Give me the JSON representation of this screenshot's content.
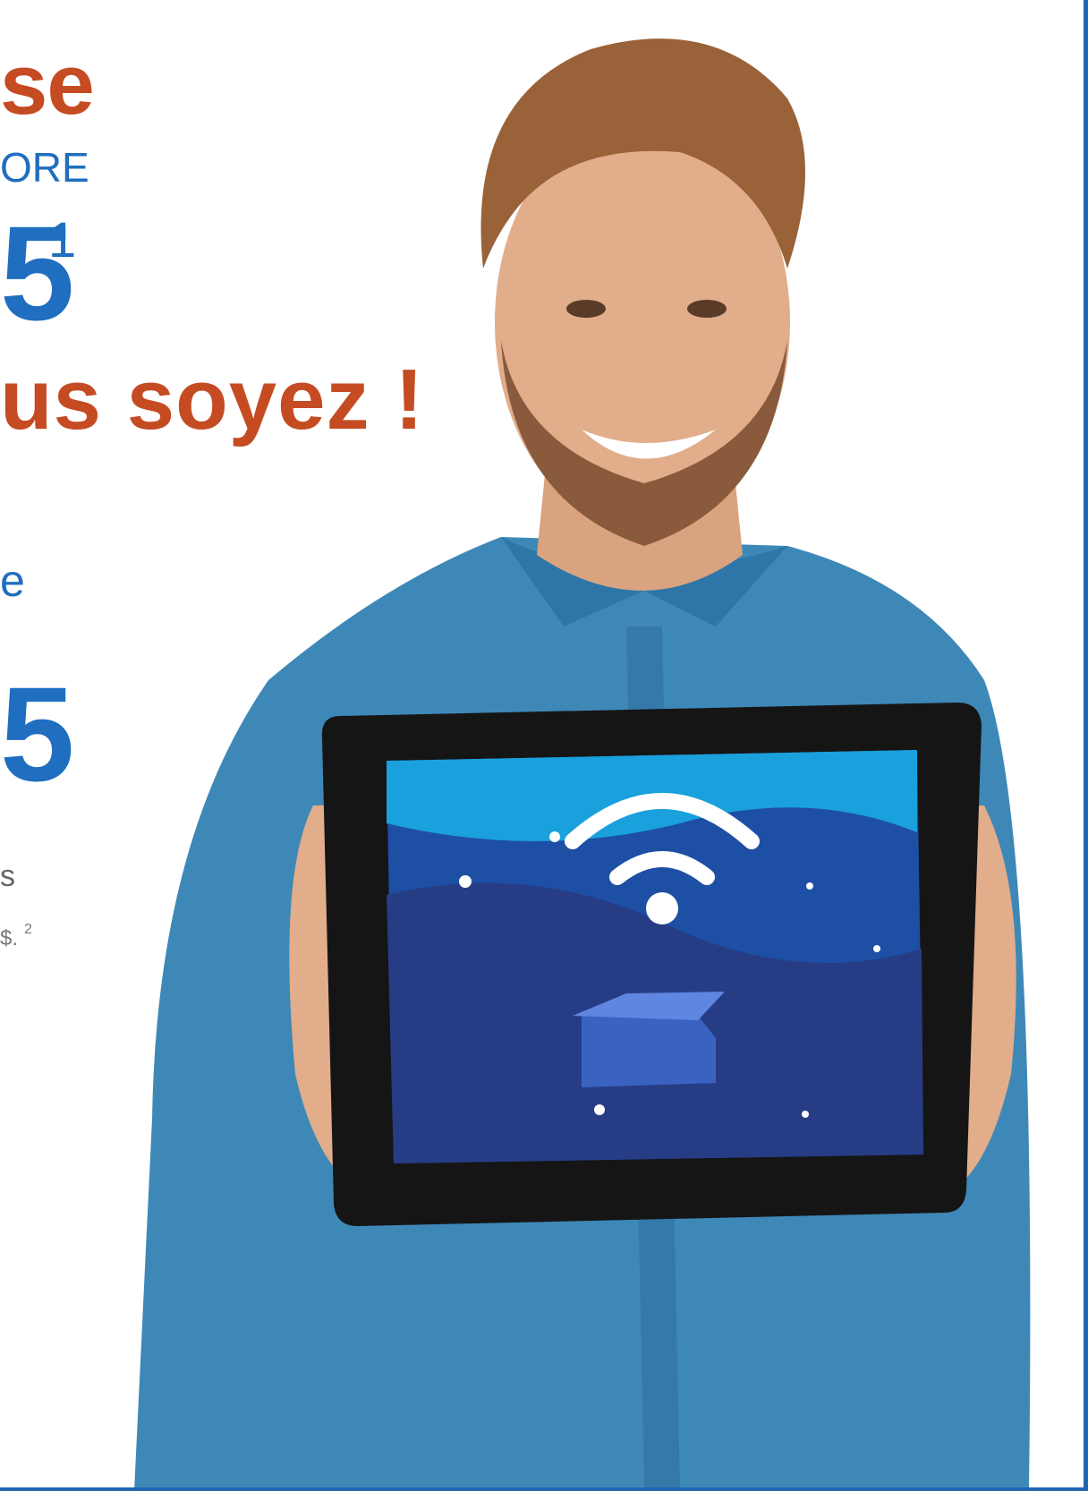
{
  "headline_top": "se",
  "kicker": "ORE",
  "big_number_1": "5",
  "footnote_1": "1",
  "headline_2": "us soyez !",
  "blue_word": "e",
  "big_number_2": "5",
  "grey_line_1": "s",
  "grey_line_2": "$.",
  "footnote_2": "2",
  "colors": {
    "accent_orange": "#c54b22",
    "brand_blue": "#1f6ebf",
    "frame_blue": "#1f67b1"
  },
  "image": {
    "subject": "smiling man in denim shirt holding a tablet",
    "tablet_screen_icon": "wifi-icon"
  }
}
